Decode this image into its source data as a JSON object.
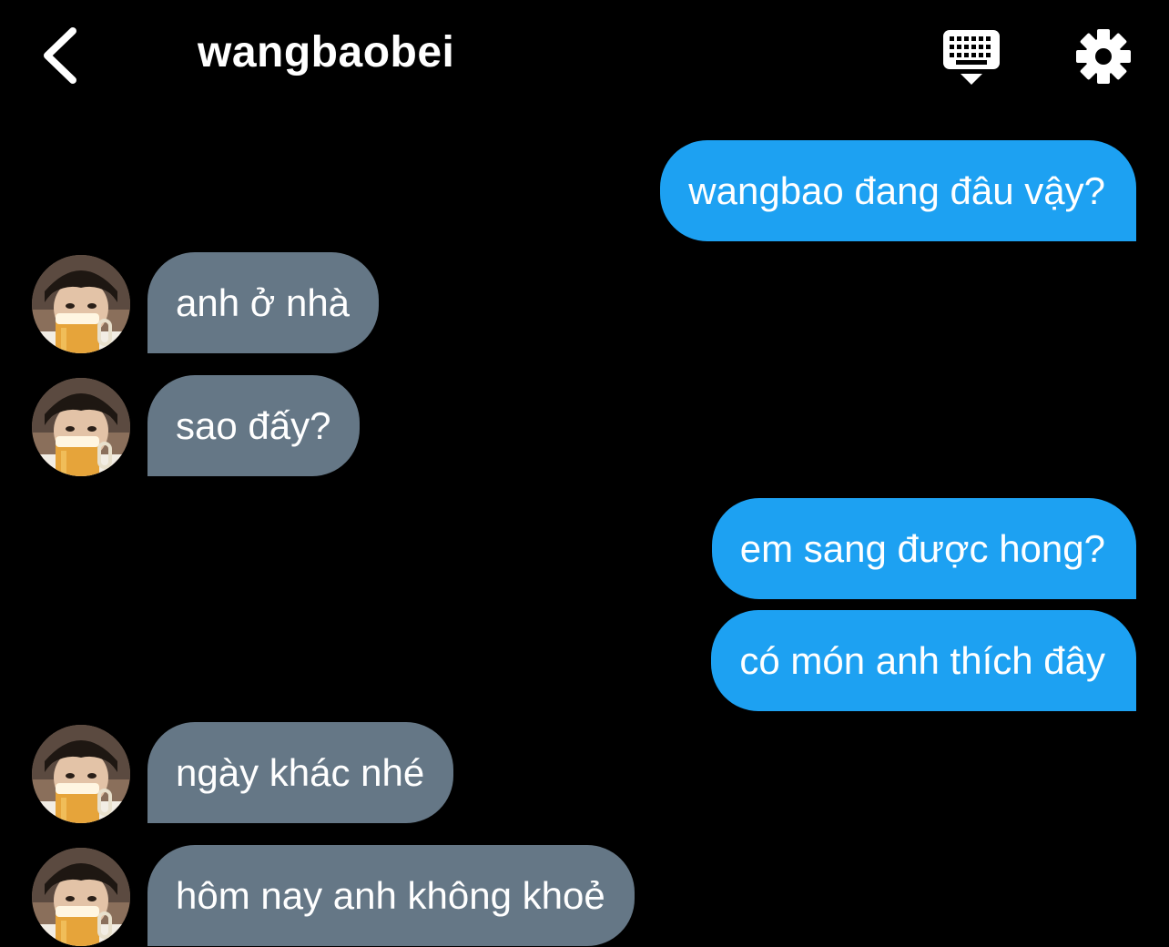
{
  "header": {
    "title": "wangbaobei",
    "icons": {
      "back": "chevron-left-icon",
      "keyboard": "keyboard-icon",
      "settings": "gear-icon"
    }
  },
  "colors": {
    "background": "#000000",
    "sent_bubble": "#1da1f2",
    "received_bubble": "#657786",
    "text": "#ffffff"
  },
  "messages": [
    {
      "from": "me",
      "text": "wangbao đang đâu vậy?"
    },
    {
      "from": "them",
      "text": "anh ở nhà"
    },
    {
      "from": "them",
      "text": "sao đấy?"
    },
    {
      "from": "me",
      "text": "em sang được hong?"
    },
    {
      "from": "me",
      "text": "có món anh thích đây"
    },
    {
      "from": "them",
      "text": "ngày khác nhé"
    },
    {
      "from": "them",
      "text": "hôm nay anh không khoẻ"
    }
  ]
}
